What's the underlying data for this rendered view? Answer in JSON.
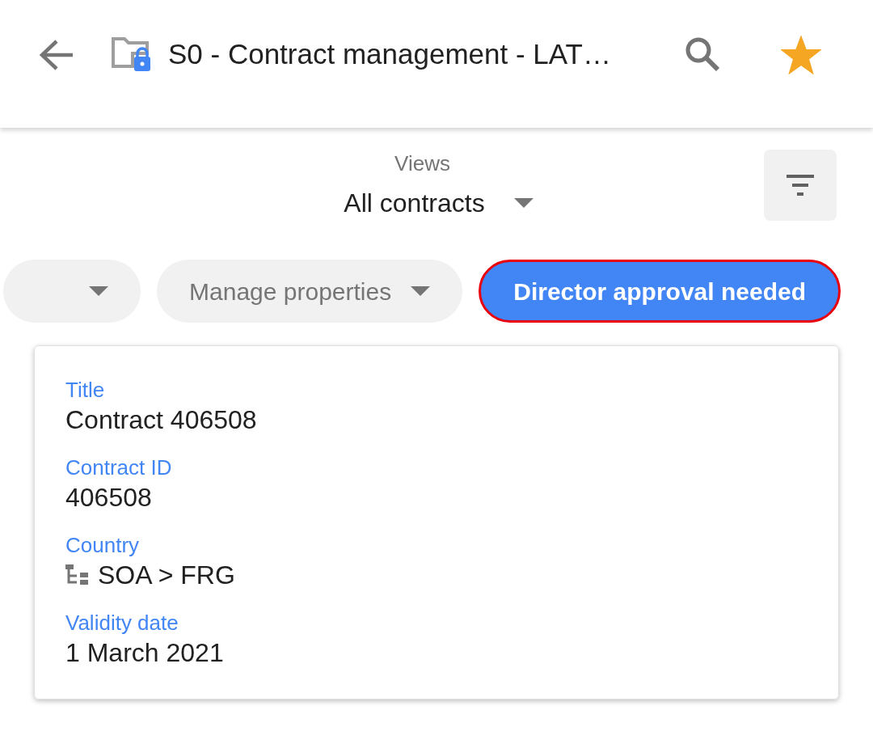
{
  "header": {
    "title": "S0 - Contract management - LAT…",
    "starred": true
  },
  "views": {
    "label": "Views",
    "value": "All contracts"
  },
  "chips": [
    {
      "selected": false,
      "dropdown": true
    },
    {
      "label": "Manage properties",
      "selected": false,
      "dropdown": true
    },
    {
      "label": "Director approval needed",
      "selected": true,
      "dropdown": false
    }
  ],
  "card": {
    "fields": [
      {
        "label": "Title",
        "value": "Contract 406508",
        "kind": "text"
      },
      {
        "label": "Contract ID",
        "value": "406508",
        "kind": "text"
      },
      {
        "label": "Country",
        "value": "SOA > FRG",
        "kind": "hierarchy"
      },
      {
        "label": "Validity date",
        "value": "1 March 2021",
        "kind": "text"
      }
    ]
  }
}
